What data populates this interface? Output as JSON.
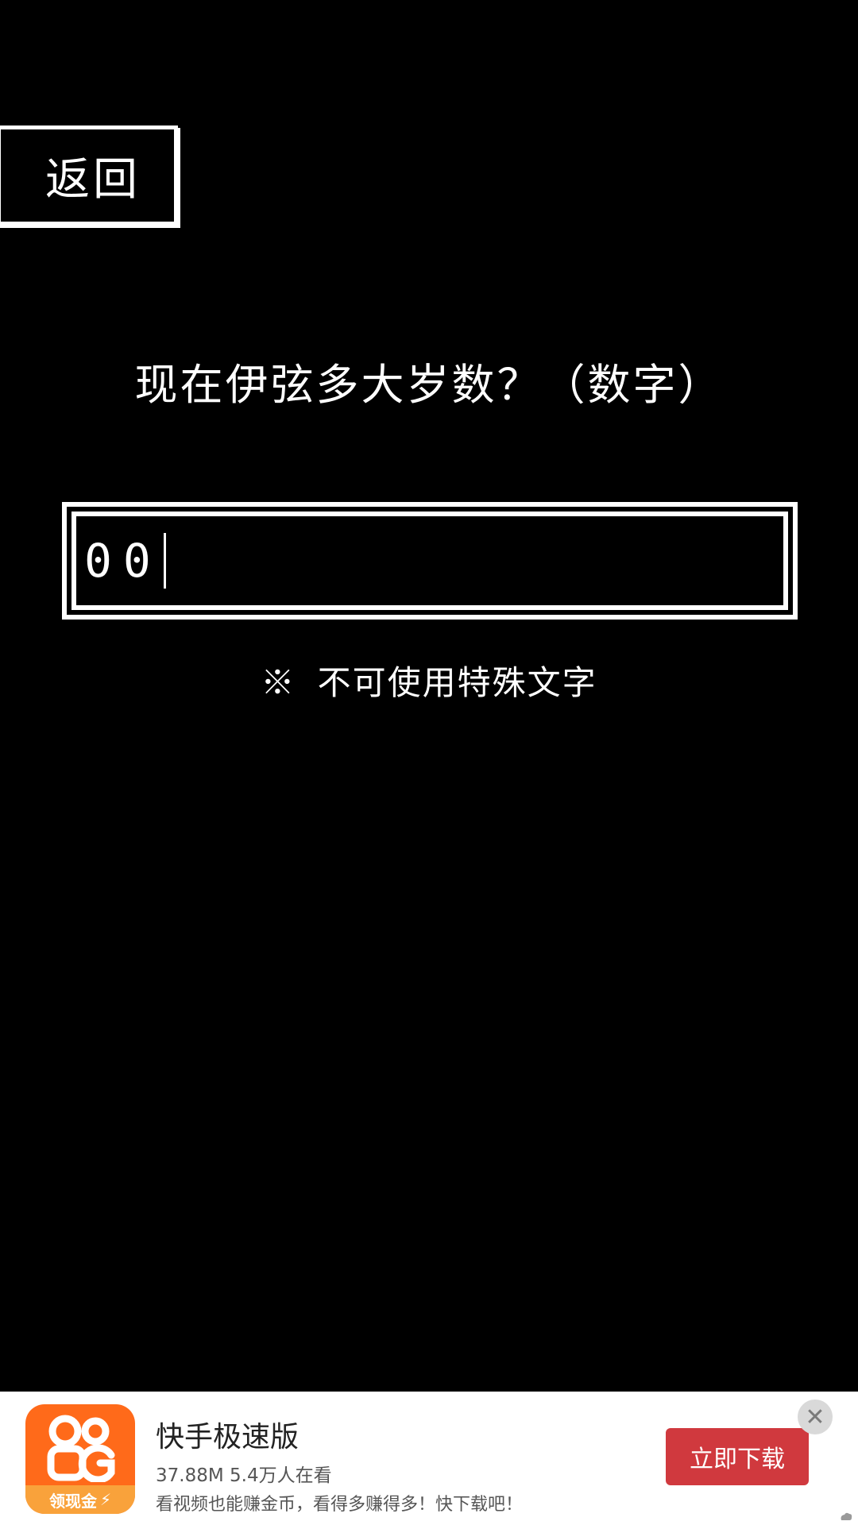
{
  "back_button": {
    "label": "返回"
  },
  "question": {
    "text": "现在伊弦多大岁数？（数字）"
  },
  "answer_input": {
    "value": "00"
  },
  "hint": {
    "text": "※ 不可使用特殊文字"
  },
  "ad": {
    "logo_caption": "领现金",
    "title": "快手极速版",
    "meta": "37.88M 5.4万人在看",
    "description": "看视频也能赚金币，看得多赚得多！快下载吧！",
    "download_label": "立即下载",
    "close_symbol": "✕",
    "colors": {
      "logo_bg": "#ff6a1a",
      "logo_strip": "#f9a23b",
      "download_bg": "#d0393e"
    }
  }
}
